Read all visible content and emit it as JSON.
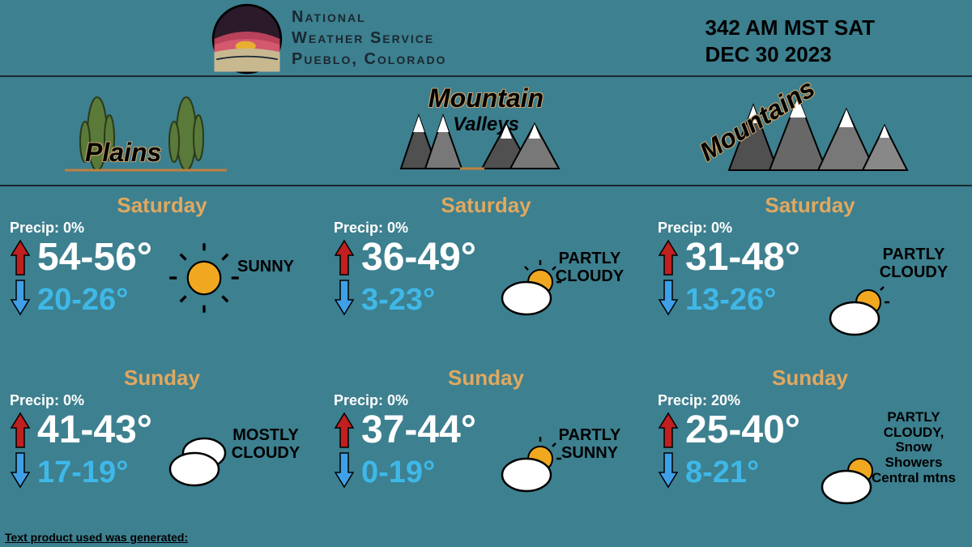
{
  "header": {
    "agency_line1": "National",
    "agency_line2": "Weather Service",
    "agency_line3": "Pueblo, Colorado",
    "timestamp_line1": "342 AM MST SAT",
    "timestamp_line2": "DEC 30 2023"
  },
  "regions": [
    {
      "name": "Plains",
      "sub": ""
    },
    {
      "name": "Mountain",
      "sub": "Valleys"
    },
    {
      "name": "Mountains",
      "sub": ""
    }
  ],
  "forecasts": {
    "plains": {
      "sat": {
        "day": "Saturday",
        "precip": "Precip: 0%",
        "high": "54-56°",
        "low": "20-26°",
        "cond": "SUNNY",
        "icon": "sunny"
      },
      "sun": {
        "day": "Sunday",
        "precip": "Precip: 0%",
        "high": "41-43°",
        "low": "17-19°",
        "cond": "MOSTLY CLOUDY",
        "icon": "mostly-cloudy"
      }
    },
    "valleys": {
      "sat": {
        "day": "Saturday",
        "precip": "Precip: 0%",
        "high": "36-49°",
        "low": "3-23°",
        "cond": "PARTLY CLOUDY",
        "icon": "partly-cloudy"
      },
      "sun": {
        "day": "Sunday",
        "precip": "Precip: 0%",
        "high": "37-44°",
        "low": "0-19°",
        "cond": "PARTLY SUNNY",
        "icon": "partly-cloudy"
      }
    },
    "mountains": {
      "sat": {
        "day": "Saturday",
        "precip": "Precip: 0%",
        "high": "31-48°",
        "low": "13-26°",
        "cond": "PARTLY CLOUDY",
        "icon": "partly-cloudy"
      },
      "sun": {
        "day": "Sunday",
        "precip": "Precip: 20%",
        "high": "25-40°",
        "low": "8-21°",
        "cond": "PARTLY CLOUDY, Snow Showers Central mtns",
        "icon": "partly-cloudy"
      }
    }
  },
  "footer": "Text product used was generated:"
}
